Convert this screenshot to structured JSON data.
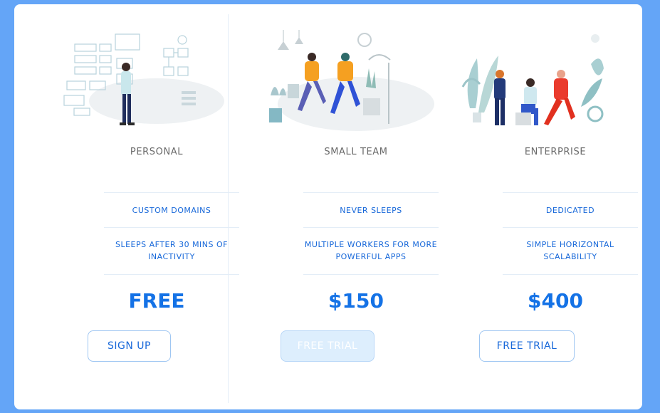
{
  "plans": [
    {
      "name": "PERSONAL",
      "features": [
        "CUSTOM DOMAINS",
        "SLEEPS AFTER 30 MINS OF INACTIVITY"
      ],
      "price": "FREE",
      "button": "SIGN UP"
    },
    {
      "name": "SMALL TEAM",
      "features": [
        "NEVER SLEEPS",
        "MULTIPLE WORKERS FOR MORE POWERFUL APPS"
      ],
      "price": "$150",
      "button": "FREE TRIAL"
    },
    {
      "name": "ENTERPRISE",
      "features": [
        "DEDICATED",
        "SIMPLE HORIZONTAL SCALABILITY"
      ],
      "price": "$400",
      "button": "FREE TRIAL"
    }
  ],
  "colors": {
    "background": "#64a5f7",
    "accent": "#1472e6",
    "text_blue": "#1667d9",
    "active_button": "#ddeefd"
  },
  "icons": [
    "personal-illustration",
    "team-illustration",
    "enterprise-illustration"
  ]
}
